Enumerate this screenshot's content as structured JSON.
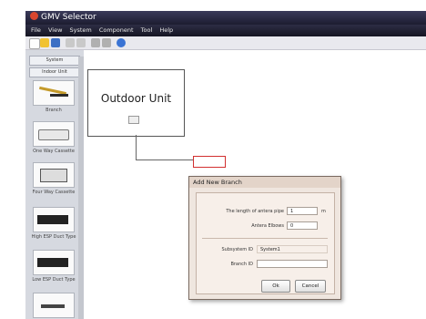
{
  "window": {
    "title": "GMV Selector"
  },
  "menu": [
    "File",
    "View",
    "System",
    "Component",
    "Tool",
    "Help"
  ],
  "sidebar": {
    "tabs": [
      "System",
      "Indoor Unit"
    ],
    "items": [
      {
        "label": "Branch",
        "icon": "branch-pipe-icon"
      },
      {
        "label": "One Way Cassette",
        "icon": "cassette-icon"
      },
      {
        "label": "Four Way Cassette",
        "icon": "cassette-icon"
      },
      {
        "label": "High ESP Duct Type",
        "icon": "duct-icon"
      },
      {
        "label": "Low ESP Duct Type",
        "icon": "duct-icon"
      }
    ]
  },
  "canvas": {
    "outdoor_unit_label": "Outdoor Unit"
  },
  "dialog": {
    "title": "Add New Branch",
    "fields": {
      "pipe_length": {
        "label": "The length of antera pipe",
        "value": "1",
        "unit": "m"
      },
      "elbows": {
        "label": "Antera Elbows",
        "value": "0"
      },
      "subsystem_id": {
        "label": "Subsystem ID",
        "value": "System1"
      },
      "branch_id": {
        "label": "Branch ID",
        "value": ""
      }
    },
    "ok_label": "Ok",
    "cancel_label": "Cancel"
  }
}
